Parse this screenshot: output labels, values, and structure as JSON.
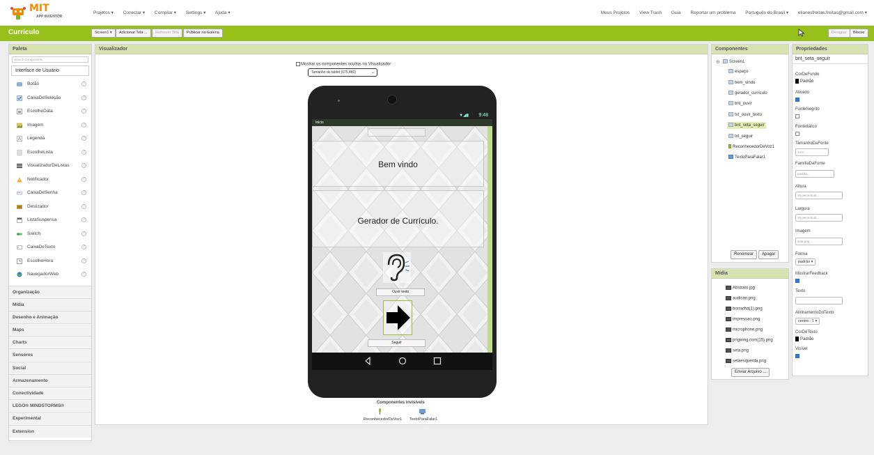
{
  "logo": {
    "brand": "MIT",
    "subtitle": "APP INVENTOR"
  },
  "top_menu": {
    "left": [
      "Projetos ▾",
      "Conectar ▾",
      "Compilar ▾",
      "Settings ▾",
      "Ajuda ▾"
    ],
    "right": [
      "Meus Projetos",
      "View Trash",
      "Guia",
      "Reportar um problema",
      "Português do Brasil ▾",
      "elianesfreitas.freitas@gmail.com ▾"
    ]
  },
  "project_bar": {
    "name": "Currículo",
    "screen_button": "Screen1 ▾",
    "add_screen": "Adicionar Tela ...",
    "remove_screen": "Remover Tela",
    "publish": "Publicar na Galeria",
    "designer": "Designer",
    "blocks": "Blocos",
    "accent_color": "#96c01a"
  },
  "palette": {
    "title": "Paleta",
    "search_placeholder": "Search Components...",
    "open_category": "Interface de Usuário",
    "items": [
      "Botão",
      "CaixaDeSeleção",
      "EscolheData",
      "Imagem",
      "Legenda",
      "EscolheLista",
      "VisualizadorDeListas",
      "Notificador",
      "CaixaDeSenha",
      "Deslizador",
      "ListaSuspensa",
      "Switch",
      "CaixaDeTexto",
      "EscolheHora",
      "NavegadorWeb"
    ],
    "help_glyph": "?",
    "categories": [
      "Organização",
      "Mídia",
      "Desenho e Animação",
      "Maps",
      "Charts",
      "Sensores",
      "Social",
      "Armazenamento",
      "Conectividade",
      "LEGO® MINDSTORMS®",
      "Experimental",
      "Extension"
    ]
  },
  "viewer": {
    "title": "Visualizador",
    "show_hidden": "Mostrar os componentes ocultos no Visualizador",
    "size_select": "Tamanho do tablet (675,480)",
    "status_time": "9:48",
    "screen_title": "Inicio",
    "label_welcome": "Bem vindo",
    "label_generator": "Gerador de Currículo.",
    "btn_listen": "Ouvir texto",
    "btn_next": "Seguir",
    "invisible_title": "Componentes invisíveis",
    "invisible_items": [
      "ReconhecedorDeVoz1",
      "TextoParaFalar1"
    ]
  },
  "components": {
    "title": "Componentes",
    "root": "Screen1",
    "children": [
      "espaço",
      "bem_vindo",
      "gerador_curriculo",
      "bnt_ouvir",
      "txt_ouvir_texto",
      "bnt_seta_seguir",
      "txt_seguir",
      "ReconhecedorDeVoz1",
      "TextoParaFalar1"
    ],
    "selected": "bnt_seta_seguir",
    "rename": "Renomear",
    "delete": "Apagar"
  },
  "media": {
    "title": "Mídia",
    "files": [
      "Abstrato.jpg",
      "audicao.png",
      "borracha(1).png",
      "impressao.png",
      "microphone.png",
      "pngwing.com(15).png",
      "seta.png",
      "setaesquerda.png"
    ],
    "upload": "Enviar Arquivo ..."
  },
  "properties": {
    "title": "Propriedades",
    "component": "bnt_seta_seguir",
    "cor_fundo_label": "CorDeFundo",
    "cor_fundo_value": "Padrão",
    "ativado_label": "Ativado",
    "negrito_label": "FonteNegrito",
    "italico_label": "FonteItálico",
    "tamanho_label": "TamanhoDaFonte",
    "tamanho_value": "14.0",
    "familia_label": "FamíliaDaFonte",
    "familia_value": "padrão...",
    "altura_label": "Altura",
    "altura_value": "15 percentual...",
    "largura_label": "Largura",
    "largura_value": "15 percentual...",
    "imagem_label": "Imagem",
    "imagem_value": "seta.png...",
    "forma_label": "Forma",
    "forma_value": "padrão ▾",
    "feedback_label": "MostrarFeedback",
    "texto_label": "Texto",
    "texto_value": "",
    "alinhamento_label": "AlinhamentoDoTexto",
    "alinhamento_value": "centro : 1 ▾",
    "cor_texto_label": "CorDeTexto",
    "cor_texto_value": "Padrão",
    "visivel_label": "Visível"
  }
}
